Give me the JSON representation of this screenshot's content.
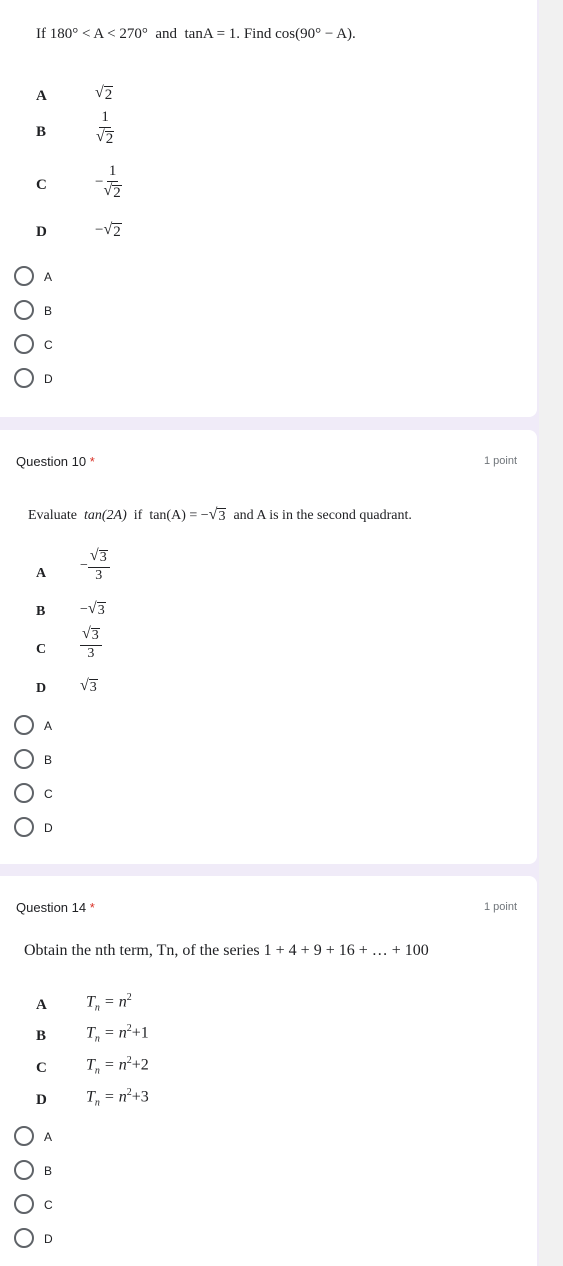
{
  "q9": {
    "prompt_if": "If",
    "prompt_cond": "180° < A < 270°",
    "prompt_and": "and",
    "prompt_tan": "tanA = 1.",
    "prompt_find": "Find",
    "prompt_target": "cos(90° − A).",
    "options": [
      {
        "letter": "A",
        "num": "",
        "den": "",
        "sign": "",
        "rad": "2"
      },
      {
        "letter": "B",
        "num": "1",
        "rad": "2",
        "sign": ""
      },
      {
        "letter": "C",
        "num": "1",
        "rad": "2",
        "sign": "−"
      },
      {
        "letter": "D",
        "rad": "2",
        "sign": "−"
      }
    ],
    "radios": [
      "A",
      "B",
      "C",
      "D"
    ]
  },
  "q10": {
    "title": "Question 10",
    "required": "*",
    "points": "1 point",
    "prompt_evaluate": "Evaluate",
    "prompt_expr": "tan(2A)",
    "prompt_if": "if",
    "prompt_cond": "tan(A) = −",
    "prompt_rad": "3",
    "prompt_rest": "and A is in the second quadrant.",
    "options": [
      {
        "letter": "A",
        "sign": "−",
        "rad": "3",
        "den": "3"
      },
      {
        "letter": "B",
        "sign": "−",
        "rad": "3"
      },
      {
        "letter": "C",
        "rad": "3",
        "den": "3"
      },
      {
        "letter": "D",
        "rad": "3"
      }
    ],
    "radios": [
      "A",
      "B",
      "C",
      "D"
    ]
  },
  "q14": {
    "title": "Question 14",
    "required": "*",
    "points": "1 point",
    "prompt": "Obtain the nth term, Tn, of the series",
    "series": "1 + 4 + 9 + 16 + … + 100",
    "options": [
      {
        "letter": "A",
        "lhs": "T",
        "sub": "n",
        "rhs": "= n",
        "sup": "2",
        "tail": ""
      },
      {
        "letter": "B",
        "lhs": "T",
        "sub": "n",
        "rhs": "= n",
        "sup": "2",
        "tail": "+1"
      },
      {
        "letter": "C",
        "lhs": "T",
        "sub": "n",
        "rhs": "= n",
        "sup": "2",
        "tail": "+2"
      },
      {
        "letter": "D",
        "lhs": "T",
        "sub": "n",
        "rhs": "= n",
        "sup": "2",
        "tail": "+3"
      }
    ],
    "radios": [
      "A",
      "B",
      "C",
      "D"
    ]
  },
  "colors": {
    "background": "#f0ebf8",
    "required": "#d93025",
    "radio_border": "#5f6368"
  }
}
